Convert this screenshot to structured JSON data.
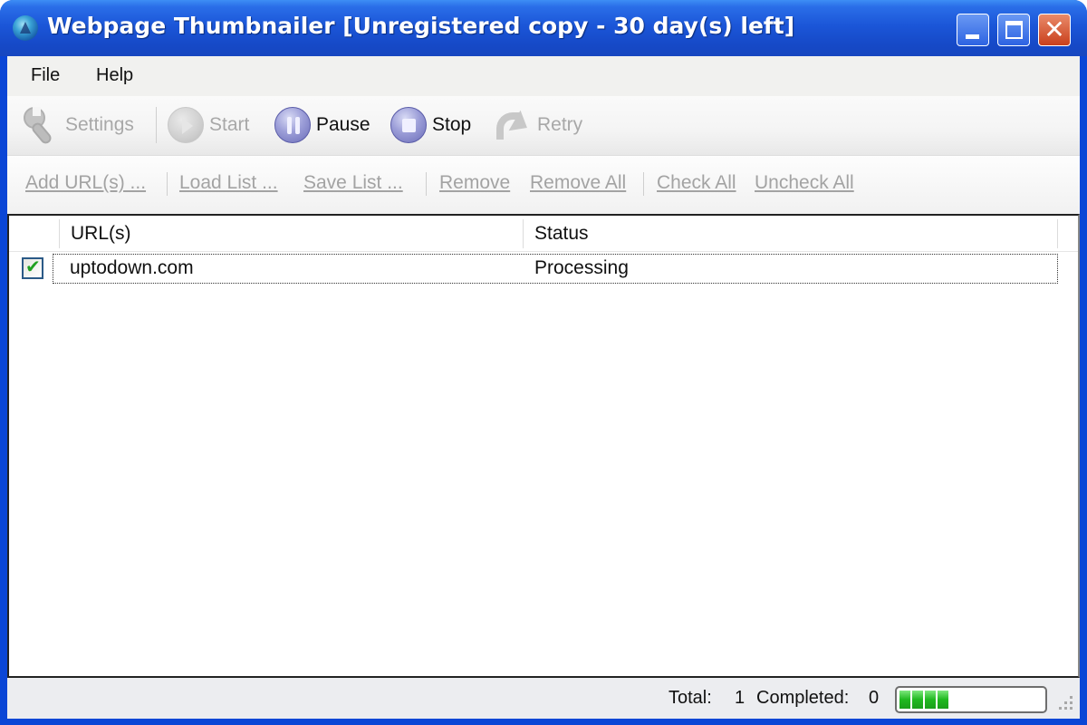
{
  "window": {
    "title": "Webpage Thumbnailer [Unregistered copy - 30 day(s) left]",
    "controls": {
      "minimize": "minimize",
      "maximize": "maximize",
      "close": "✕"
    }
  },
  "menu": {
    "items": [
      {
        "label": "File"
      },
      {
        "label": "Help"
      }
    ]
  },
  "toolbar": {
    "buttons": [
      {
        "label": "Settings",
        "icon": "wrench-icon",
        "enabled": false
      },
      {
        "label": "Start",
        "icon": "play-icon",
        "enabled": false
      },
      {
        "label": "Pause",
        "icon": "pause-icon",
        "enabled": true
      },
      {
        "label": "Stop",
        "icon": "stop-icon",
        "enabled": true
      },
      {
        "label": "Retry",
        "icon": "retry-icon",
        "enabled": false
      }
    ]
  },
  "linkbar": {
    "links": [
      {
        "label": "Add URL(s) ..."
      },
      {
        "label": "Load List ..."
      },
      {
        "label": "Save List ..."
      },
      {
        "label": "Remove"
      },
      {
        "label": "Remove All"
      },
      {
        "label": "Check All"
      },
      {
        "label": "Uncheck All"
      }
    ]
  },
  "list": {
    "columns": [
      {
        "label": "URL(s)"
      },
      {
        "label": "Status"
      }
    ],
    "rows": [
      {
        "checked": true,
        "url": "uptodown.com",
        "status": "Processing"
      }
    ]
  },
  "status": {
    "total_label": "Total:",
    "total_value": "1",
    "completed_label": "Completed:",
    "completed_value": "0",
    "progress_fraction": 0.35,
    "progress_color": "#1fb81f"
  }
}
